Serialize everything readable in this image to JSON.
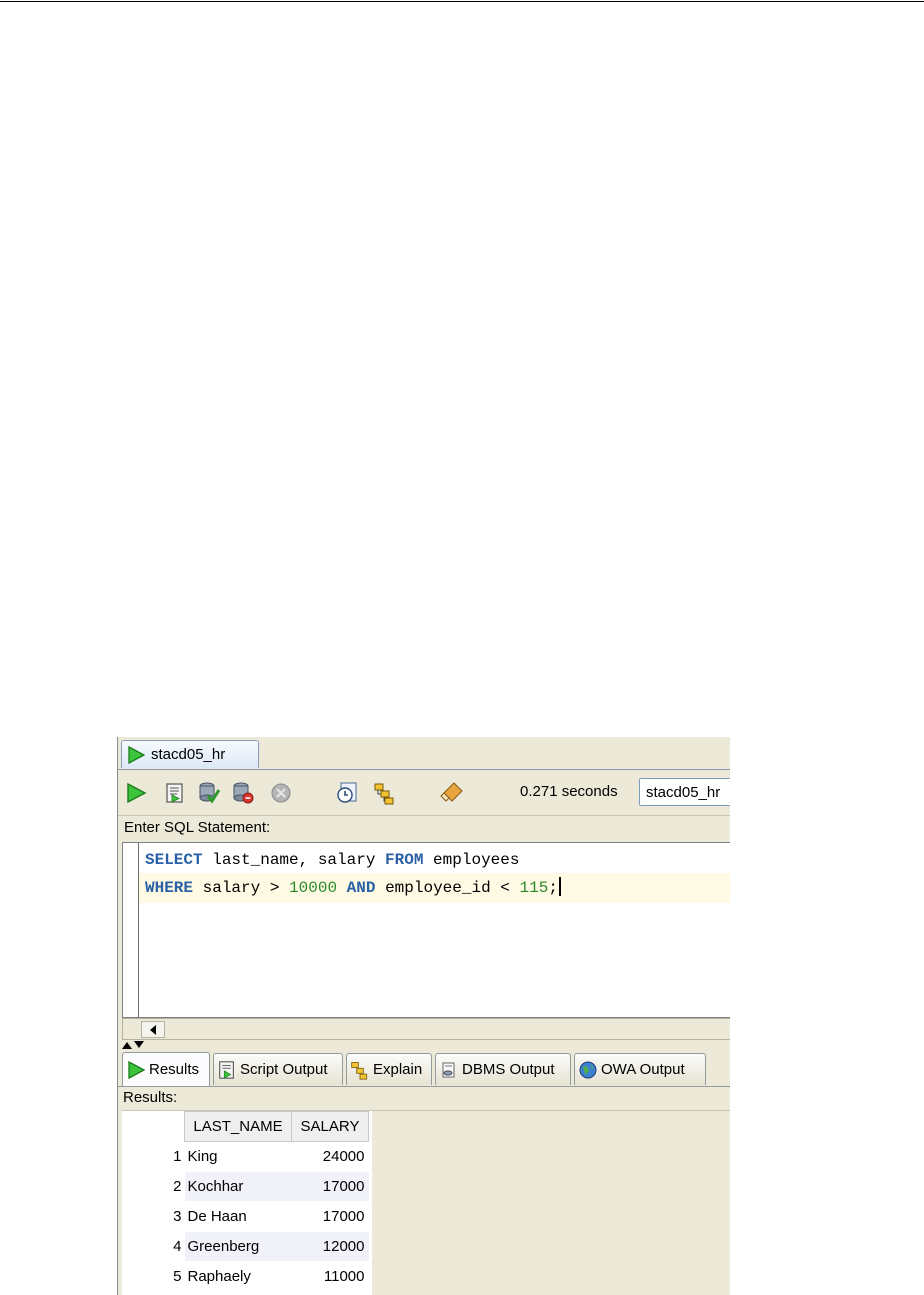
{
  "worksheet": {
    "tab_label": "stacd05_hr"
  },
  "toolbar": {
    "buttons": [
      "execute-statement",
      "run-script",
      "commit",
      "rollback",
      "cancel",
      "sql-history",
      "explain-plan",
      "clear"
    ],
    "elapsed": "0.271 seconds",
    "connection": "stacd05_hr"
  },
  "editor": {
    "label": "Enter SQL Statement:",
    "lines": [
      [
        {
          "t": "SELECT",
          "c": "kw"
        },
        {
          "t": " last_name, salary ",
          "c": ""
        },
        {
          "t": "FROM",
          "c": "kw"
        },
        {
          "t": " employees",
          "c": ""
        }
      ],
      [
        {
          "t": "WHERE",
          "c": "kw"
        },
        {
          "t": " salary > ",
          "c": ""
        },
        {
          "t": "10000",
          "c": "num"
        },
        {
          "t": " ",
          "c": ""
        },
        {
          "t": "AND",
          "c": "kw"
        },
        {
          "t": " employee_id < ",
          "c": ""
        },
        {
          "t": "115",
          "c": "num"
        },
        {
          "t": ";",
          "c": ""
        }
      ]
    ]
  },
  "result_tabs": [
    {
      "label": "Results",
      "icon": "play-icon",
      "active": true
    },
    {
      "label": "Script Output",
      "icon": "script-icon",
      "active": false
    },
    {
      "label": "Explain",
      "icon": "explain-icon",
      "active": false
    },
    {
      "label": "DBMS Output",
      "icon": "dbms-icon",
      "active": false
    },
    {
      "label": "OWA Output",
      "icon": "globe-icon",
      "active": false
    }
  ],
  "results": {
    "label": "Results:",
    "columns": [
      "LAST_NAME",
      "SALARY"
    ],
    "rows": [
      {
        "n": "1",
        "last_name": "King",
        "salary": "24000"
      },
      {
        "n": "2",
        "last_name": "Kochhar",
        "salary": "17000"
      },
      {
        "n": "3",
        "last_name": "De Haan",
        "salary": "17000"
      },
      {
        "n": "4",
        "last_name": "Greenberg",
        "salary": "12000"
      },
      {
        "n": "5",
        "last_name": "Raphaely",
        "salary": "11000"
      }
    ]
  },
  "colors": {
    "keyword": "#2a61a6",
    "number": "#2a8a2a",
    "current_line": "#fffae3",
    "run_green": "#2fb52f"
  }
}
